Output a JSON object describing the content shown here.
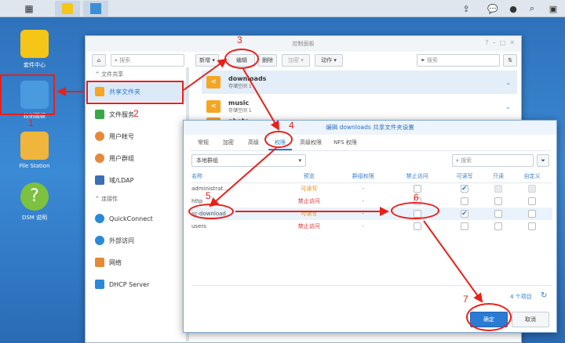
{
  "taskbar": {
    "icons": [
      "main-menu-icon",
      "package-center-app-icon",
      "control-panel-app-icon"
    ],
    "right_icons": [
      "upload-icon",
      "chat-icon",
      "user-icon",
      "search-icon",
      "widgets-icon"
    ]
  },
  "desktop": {
    "icons": [
      {
        "label": "套件中心"
      },
      {
        "label": "控制面板"
      },
      {
        "label": "File Station"
      },
      {
        "label": "DSM 说明"
      }
    ]
  },
  "control_panel": {
    "title": "控制面板",
    "search_placeholder": "搜索",
    "sidebar": {
      "section1": "文件共享",
      "items": [
        {
          "label": "共享文件夹"
        },
        {
          "label": "文件服务"
        },
        {
          "label": "用户帐号"
        },
        {
          "label": "用户群组"
        },
        {
          "label": "域/LDAP"
        }
      ],
      "section2": "连接性",
      "items2": [
        {
          "label": "QuickConnect"
        },
        {
          "label": "外部访问"
        },
        {
          "label": "网络"
        },
        {
          "label": "DHCP Server"
        }
      ]
    },
    "toolbar": {
      "new": "新增",
      "edit": "编辑",
      "delete": "删除",
      "encrypt": "加密",
      "action": "动作",
      "filter_placeholder": "搜索"
    },
    "folders": [
      {
        "name": "downloads",
        "sub": "存储空间 1"
      },
      {
        "name": "music",
        "sub": "存储空间 1"
      },
      {
        "name": "photo",
        "sub": ""
      }
    ]
  },
  "dialog": {
    "title": "编辑 downloads 共享文件夹设置",
    "tabs": [
      "常规",
      "加密",
      "高级",
      "权限",
      "高级权限",
      "NFS 权限"
    ],
    "active_tab": 3,
    "group_select": "本地群组",
    "search_placeholder": "搜索",
    "columns": [
      "名称",
      "预览",
      "群组权限",
      "禁止访问",
      "可读写",
      "只读",
      "自定义"
    ],
    "rows": [
      {
        "name": "administrat...",
        "preview": "可读写",
        "preview_color": "#f08c00",
        "group": "-",
        "deny": false,
        "rw": true,
        "ro": "disabled",
        "custom": "disabled"
      },
      {
        "name": "http",
        "preview": "禁止访问",
        "preview_color": "#e03030",
        "group": "-",
        "deny": false,
        "rw": false,
        "ro": false,
        "custom": false
      },
      {
        "name": "sc-download",
        "preview": "可读写",
        "preview_color": "#f08c00",
        "group": "-",
        "deny": false,
        "rw": true,
        "ro": false,
        "custom": false
      },
      {
        "name": "users",
        "preview": "禁止访问",
        "preview_color": "#e03030",
        "group": "-",
        "deny": false,
        "rw": false,
        "ro": false,
        "custom": false
      }
    ],
    "count": "4 个项目",
    "ok": "确定",
    "cancel": "取消"
  },
  "annotations": [
    "1",
    "2",
    "3",
    "4",
    "5",
    "6",
    "7"
  ]
}
